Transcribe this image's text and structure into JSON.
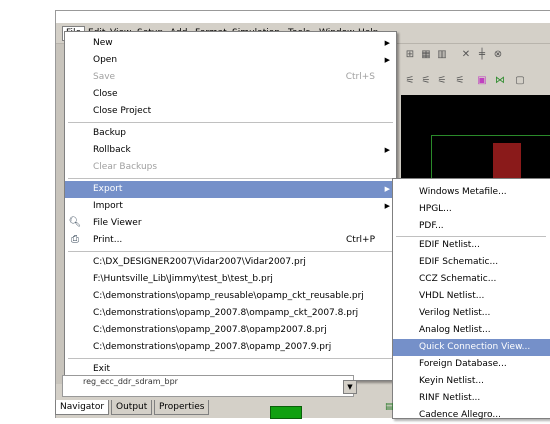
{
  "menubar": {
    "items": [
      "File",
      "Edit",
      "View",
      "Setup",
      "Add",
      "Format",
      "Simulation",
      "Tools",
      "Window",
      "Help"
    ]
  },
  "file_menu": {
    "items": [
      {
        "label": "New",
        "arrow": true
      },
      {
        "label": "Open",
        "arrow": true
      },
      {
        "label": "Save",
        "shortcut": "Ctrl+S",
        "disabled": true
      },
      {
        "label": "Close"
      },
      {
        "label": "Close Project"
      },
      {
        "label": "Backup"
      },
      {
        "label": "Rollback",
        "arrow": true
      },
      {
        "label": "Clear Backups",
        "disabled": true
      },
      {
        "label": "Export",
        "arrow": true,
        "highlighted": true
      },
      {
        "label": "Import",
        "arrow": true
      },
      {
        "label": "File Viewer",
        "icon": "file-viewer-icon"
      },
      {
        "label": "Print...",
        "shortcut": "Ctrl+P",
        "icon": "printer-icon"
      },
      {
        "label": "C:\\DX_DESIGNER2007\\Vidar2007\\Vidar2007.prj"
      },
      {
        "label": "F:\\Huntsville_Lib\\Jimmy\\test_b\\test_b.prj"
      },
      {
        "label": "C:\\demonstrations\\opamp_reusable\\opamp_ckt_reusable.prj"
      },
      {
        "label": "C:\\demonstrations\\opamp_2007.8\\ompamp_ckt_2007.8.prj"
      },
      {
        "label": "C:\\demonstrations\\opamp_2007.8\\opamp2007.8.prj"
      },
      {
        "label": "C:\\demonstrations\\opamp_2007.8\\opamp_2007.9.prj"
      },
      {
        "label": "Exit"
      }
    ]
  },
  "export_submenu": {
    "items": [
      "Windows Metafile...",
      "HPGL...",
      "PDF...",
      "EDIF Netlist...",
      "EDIF Schematic...",
      "CCZ Schematic...",
      "VHDL Netlist...",
      "Verilog Netlist...",
      "Analog Netlist...",
      "Quick Connection View...",
      "Foreign Database...",
      "Keyin Netlist...",
      "RINF Netlist...",
      "Cadence Allegro..."
    ],
    "highlighted": "Quick Connection View..."
  },
  "bottom": {
    "tree_item": "reg_ecc_ddr_sdram_bpr",
    "tabs": [
      "Navigator",
      "Output",
      "Properties"
    ]
  },
  "colors": {
    "highlight": "#7590c9",
    "menu_bg": "#ffffff",
    "window_bg": "#d4d0c8",
    "canvas_bg": "#000000"
  }
}
